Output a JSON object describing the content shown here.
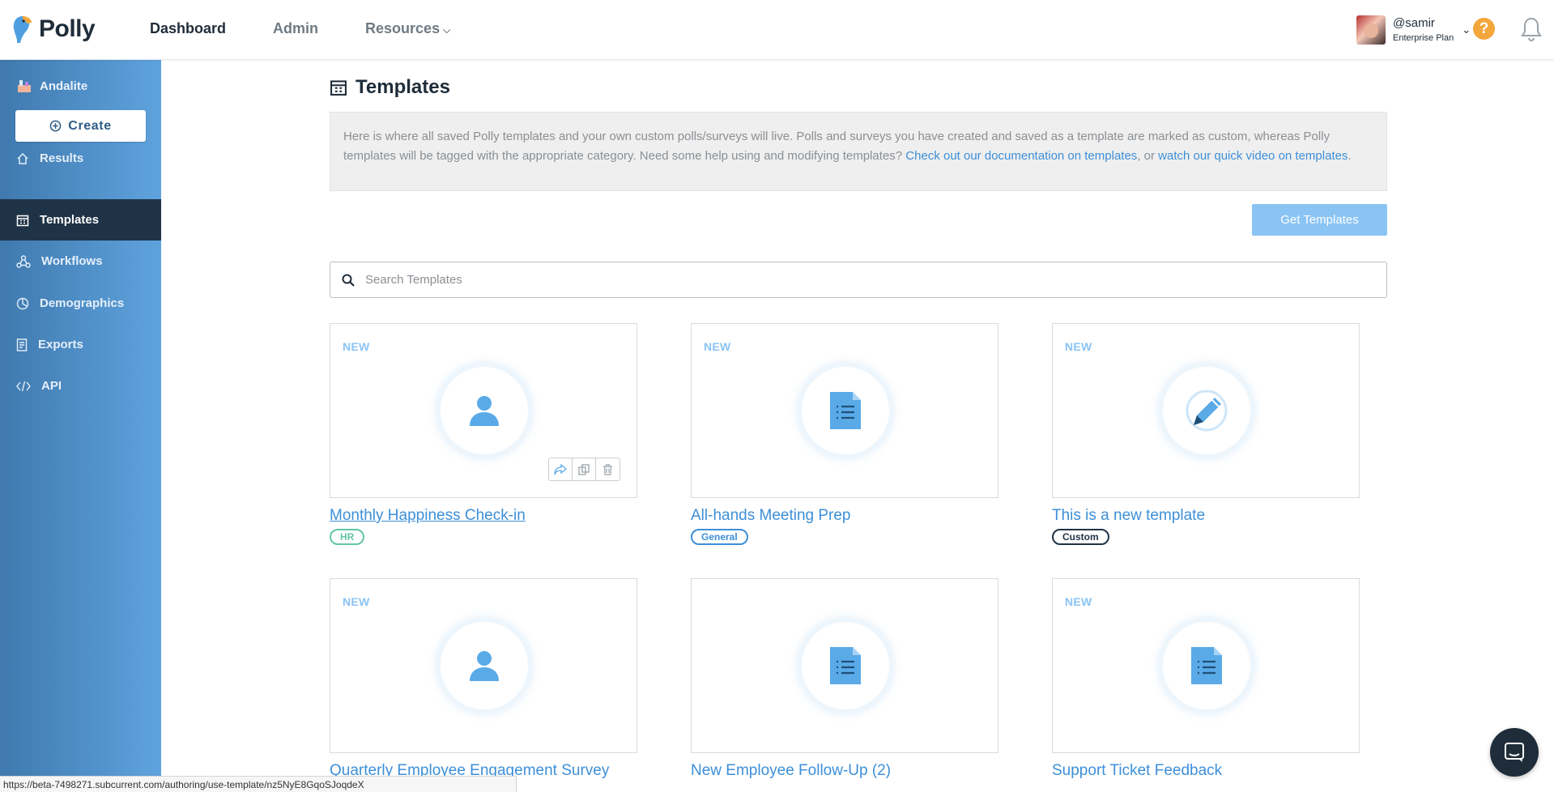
{
  "header": {
    "brand": "Polly",
    "nav": [
      {
        "label": "Dashboard",
        "active": true
      },
      {
        "label": "Admin",
        "active": false
      },
      {
        "label": "Resources",
        "active": false
      }
    ],
    "user": {
      "handle": "@samir",
      "plan": "Enterprise Plan"
    },
    "help_label": "?"
  },
  "sidebar": {
    "org": "Andalite",
    "create_label": "Create",
    "items": [
      {
        "label": "Results",
        "icon": "home-icon",
        "active": false
      },
      {
        "label": "Templates",
        "icon": "calendar-icon",
        "active": true
      },
      {
        "label": "Workflows",
        "icon": "workflow-icon",
        "active": false
      },
      {
        "label": "Demographics",
        "icon": "demographics-icon",
        "active": false
      },
      {
        "label": "Exports",
        "icon": "document-icon",
        "active": false
      },
      {
        "label": "API",
        "icon": "code-icon",
        "active": false
      }
    ]
  },
  "main": {
    "title": "Templates",
    "info_text_1": "Here is where all saved Polly templates and your own custom polls/surveys will live. Polls and surveys you have created and saved as a template are marked as custom, whereas Polly templates will be tagged with the appropriate category. Need some help using and modifying templates? ",
    "info_link_1": "Check out our documentation on templates",
    "info_text_2": ", or ",
    "info_link_2": "watch our quick video on templates",
    "info_text_3": ".",
    "get_templates_label": "Get Templates",
    "search_placeholder": "Search Templates",
    "cards": [
      {
        "badge": "NEW",
        "icon": "user-icon",
        "title": "Monthly Happiness Check-in",
        "tag": "HR"
      },
      {
        "badge": "NEW",
        "icon": "document-icon",
        "title": "All-hands Meeting Prep",
        "tag": "General"
      },
      {
        "badge": "NEW",
        "icon": "pencil-icon",
        "title": "This is a new template",
        "tag": "Custom"
      },
      {
        "badge": "NEW",
        "icon": "user-icon",
        "title": "Quarterly Employee Engagement Survey"
      },
      {
        "badge": "",
        "icon": "document-icon",
        "title": "New Employee Follow-Up (2)"
      },
      {
        "badge": "NEW",
        "icon": "document-icon",
        "title": "Support Ticket Feedback"
      }
    ]
  },
  "status_url": "https://beta-7498271.subcurrent.com/authoring/use-template/nz5NyE8GqoSJoqdeX",
  "colors": {
    "accent": "#3d8fd8",
    "sidebar_dark": "#1f3346",
    "help": "#f3a63b",
    "tag_hr": "#63c6a3"
  }
}
